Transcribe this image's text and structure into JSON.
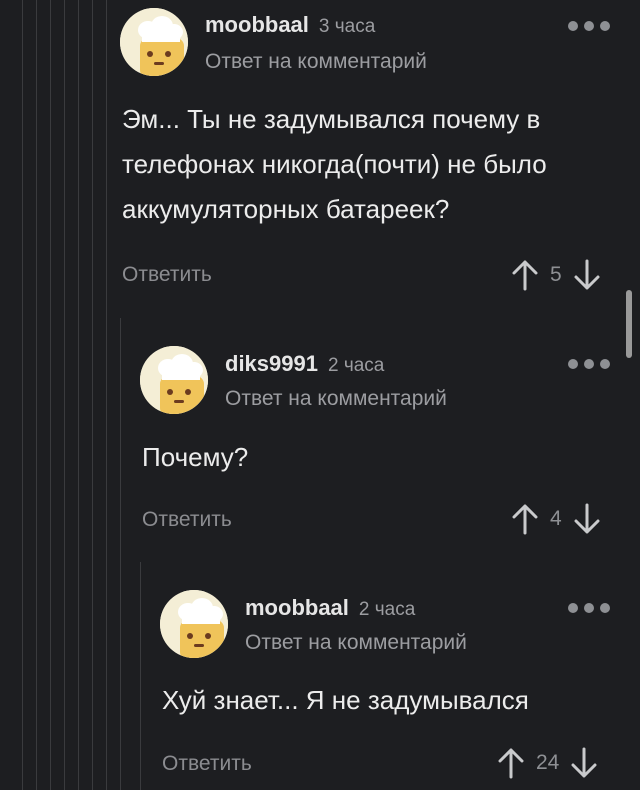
{
  "comments": [
    {
      "author": "moobbaal",
      "time": "3 часа",
      "reply_note": "Ответ на комментарий",
      "text_lines": [
        "Эм... Ты не задумывался почему в",
        "телефонах никогда(почти) не было",
        "аккумуляторных батареек?"
      ],
      "reply_label": "Ответить",
      "rating": "5",
      "avatar_icon": "chef-hat-avatar-icon"
    },
    {
      "author": "diks9991",
      "time": "2 часа",
      "reply_note": "Ответ на комментарий",
      "text_lines": [
        "Почему?"
      ],
      "reply_label": "Ответить",
      "rating": "4",
      "avatar_icon": "chef-hat-avatar-icon"
    },
    {
      "author": "moobbaal",
      "time": "2 часа",
      "reply_note": "Ответ на комментарий",
      "text_lines": [
        "Хуй знает... Я не задумывался"
      ],
      "reply_label": "Ответить",
      "rating": "24",
      "avatar_icon": "chef-hat-avatar-icon"
    }
  ],
  "colors": {
    "background": "#1d1e21",
    "thread_line": "#3a3b3e",
    "muted_text": "#9c9da1",
    "avatar_bg": "#f4eed6",
    "avatar_face": "#f0c45a"
  }
}
